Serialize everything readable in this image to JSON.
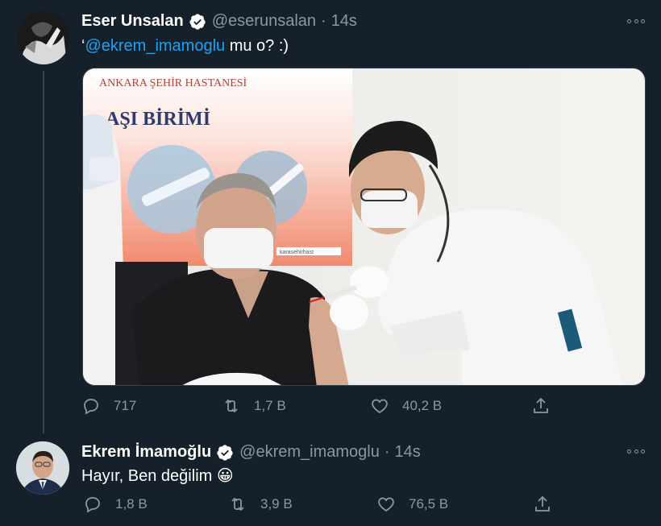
{
  "tweets": [
    {
      "author": "Eser Unsalan",
      "handle": "@eserunsalan",
      "separator": "·",
      "time": "14s",
      "text_prefix": "‘",
      "mention": "@ekrem_imamoglu",
      "text_suffix": " mu o? :)",
      "image_texts": {
        "hospital_sign": "ANKARA ŞEHİR HASTANESİ",
        "unit_sign": "AŞI BİRİMİ",
        "small_url": "karasehirhast"
      },
      "stats": {
        "replies": "717",
        "retweets": "1,7 B",
        "likes": "40,2 B"
      }
    },
    {
      "author": "Ekrem İmamoğlu",
      "handle": "@ekrem_imamoglu",
      "separator": "·",
      "time": "14s",
      "text": "Hayır, Ben değilim",
      "emoji": "😀",
      "stats": {
        "replies": "1,8 B",
        "retweets": "3,9 B",
        "likes": "76,5 B"
      }
    }
  ],
  "colors": {
    "background": "#15202b",
    "text": "#ffffff",
    "secondary": "#8899a6",
    "link": "#1da1f2",
    "verified": "#ffffff",
    "thread_line": "#38444d"
  }
}
